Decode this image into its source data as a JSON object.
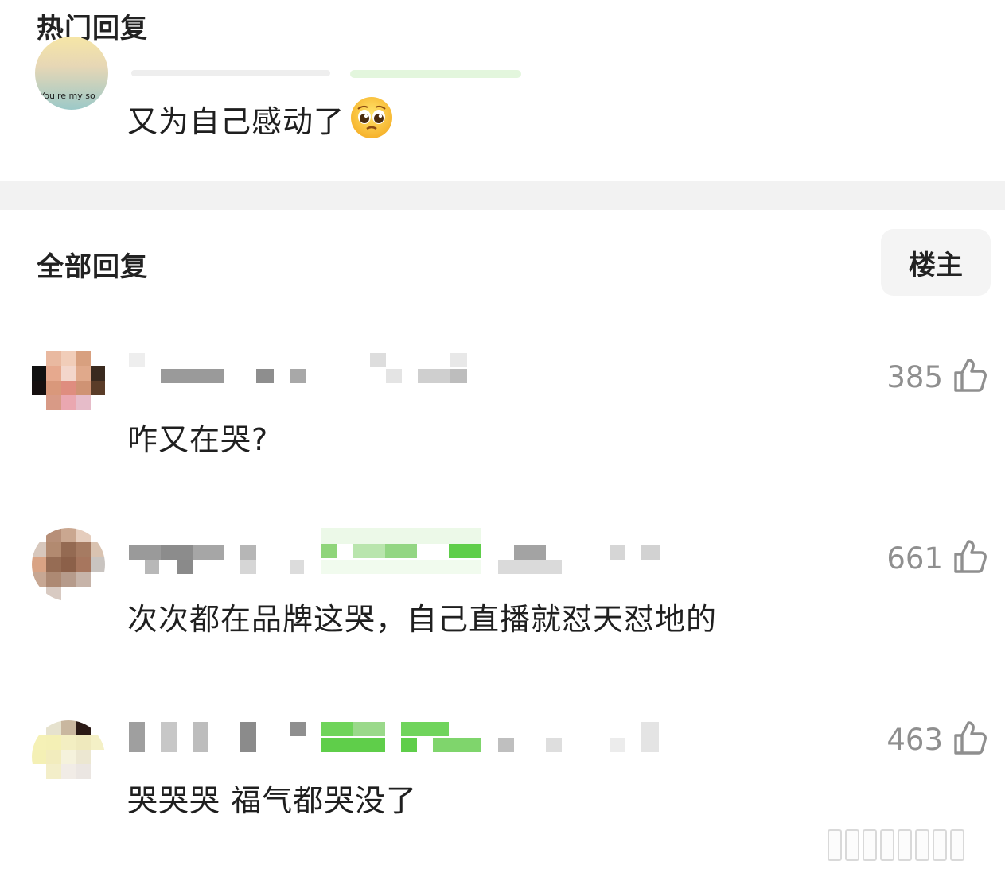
{
  "sections": {
    "hot_title": "热门回复",
    "all_title": "全部回复",
    "op_filter_label": "楼主"
  },
  "hot_reply": {
    "avatar_caption": "You're my so",
    "text": "又为自己感动了"
  },
  "replies": [
    {
      "text": "咋又在哭?",
      "likes": "385"
    },
    {
      "text": "次次都在品牌这哭，自己直播就怼天怼地的",
      "likes": "661"
    },
    {
      "text": "哭哭哭 福气都哭没了",
      "likes": "463"
    }
  ],
  "icons": {
    "like": "thumbs-up-icon",
    "emoji": "pleading-face-icon"
  },
  "colors": {
    "count_gray": "#8f8f8f",
    "band_gray": "#f2f2f2",
    "blur_green": "#5fce4a"
  }
}
